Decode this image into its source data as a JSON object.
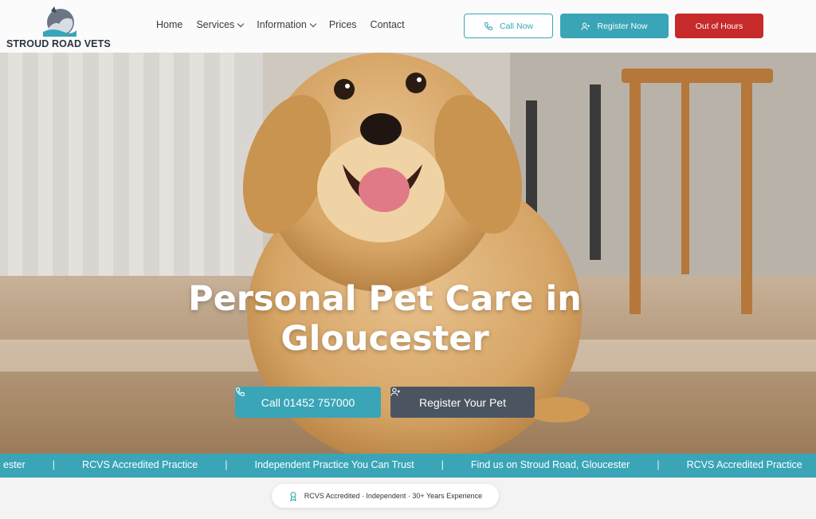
{
  "brand": {
    "name": "STROUD ROAD VETS",
    "logo_icon": "dog-cat-logo-icon",
    "accent": "#3aa5b7",
    "alert": "#c62a2a",
    "dark": "#4b5561"
  },
  "nav": {
    "items": [
      {
        "label": "Home",
        "dropdown": false
      },
      {
        "label": "Services",
        "dropdown": true
      },
      {
        "label": "Information",
        "dropdown": true
      },
      {
        "label": "Prices",
        "dropdown": false
      },
      {
        "label": "Contact",
        "dropdown": false
      }
    ]
  },
  "header_buttons": {
    "call": {
      "label": "Call Now",
      "icon": "phone-icon"
    },
    "register": {
      "label": "Register Now",
      "icon": "user-plus-icon"
    },
    "out_of_hours": {
      "label": "Out of Hours"
    }
  },
  "hero": {
    "title_line1": "Personal Pet Care in",
    "title_line2": "Gloucester",
    "call_button": {
      "label": "Call 01452 757000",
      "icon": "phone-icon"
    },
    "register_button": {
      "label": "Register Your Pet",
      "icon": "user-plus-icon"
    }
  },
  "ticker": {
    "items": [
      "ester",
      "RCVS Accredited Practice",
      "Independent Practice You Can Trust",
      "Find us on Stroud Road, Gloucester",
      "RCVS Accredited Practice"
    ],
    "separator": "|"
  },
  "badge": {
    "text": "RCVS Accredited · Independent · 30+ Years Experience",
    "icon": "award-icon"
  }
}
